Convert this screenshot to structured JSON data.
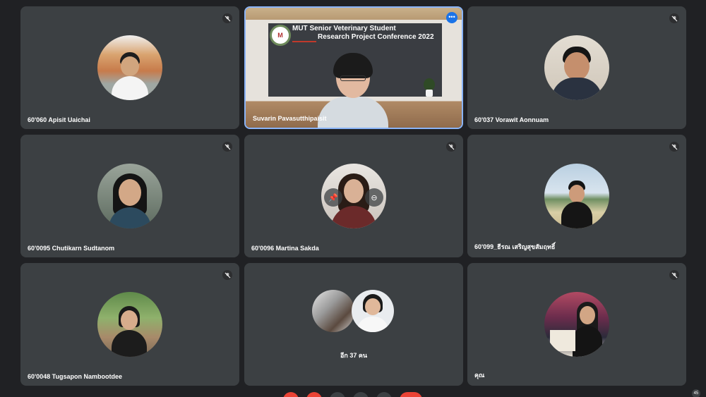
{
  "presenter": {
    "name": "Suvarin Pavasutthipaisit",
    "slide_title_line1": "MUT Senior Veterinary Student",
    "slide_title_line2": "Research Project Conference 2022",
    "more_icon": "more-options-icon"
  },
  "participants": [
    {
      "name": "60'060 Apisit Uaichai",
      "muted": true
    },
    {
      "name": "60'037 Vorawit Aonnuam",
      "muted": true
    },
    {
      "name": "60'0095 Chutikarn Sudtanom",
      "muted": true
    },
    {
      "name": "60'0096 Martina Sakda",
      "muted": true
    },
    {
      "name": "60'099_ธีรณ เสริญสุขสัมฤทธิ์",
      "muted": true
    },
    {
      "name": "60'0048 Tugsapon Nambootdee",
      "muted": true
    },
    {
      "name": "คุณ",
      "muted": true
    }
  ],
  "group": {
    "label": "อีก 37 คน"
  },
  "toolbar": {
    "participant_count": "45"
  },
  "colors": {
    "background": "#202124",
    "tile": "#3c4043",
    "active_border": "#8ab4f8",
    "end_call": "#ea4335"
  }
}
